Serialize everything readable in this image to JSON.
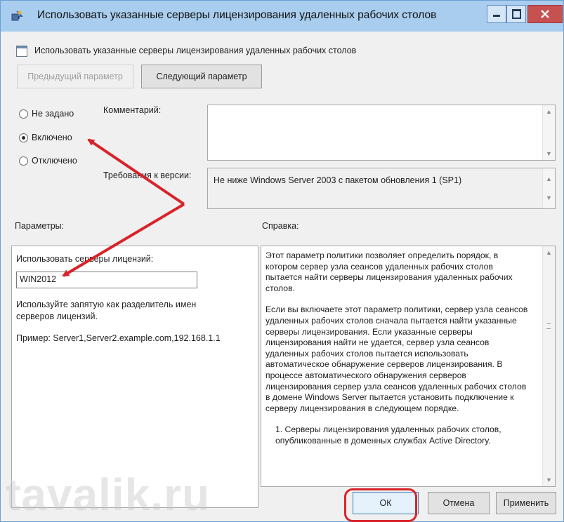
{
  "window": {
    "title": "Использовать указанные серверы лицензирования удаленных рабочих столов",
    "controls": {
      "minimize": "minimize",
      "maximize": "maximize",
      "close": "close"
    }
  },
  "header": {
    "setting_name": "Использовать указанные серверы лицензирования удаленных рабочих столов",
    "prev_button": "Предыдущий параметр",
    "next_button": "Следующий параметр"
  },
  "state": {
    "options": [
      {
        "label": "Не задано",
        "selected": false
      },
      {
        "label": "Включено",
        "selected": true
      },
      {
        "label": "Отключено",
        "selected": false
      }
    ]
  },
  "comment": {
    "label": "Комментарий:",
    "value": ""
  },
  "supported": {
    "label": "Требования к версии:",
    "value": "Не ниже Windows Server 2003 с пакетом обновления 1 (SP1)"
  },
  "params": {
    "label": "Параметры:",
    "servers_label": "Использовать серверы лицензий:",
    "servers_value": "WIN2012",
    "hint": "Используйте запятую как разделитель имен серверов лицензий.",
    "example": "Пример: Server1,Server2.example.com,192.168.1.1"
  },
  "help": {
    "label": "Справка:",
    "p1": "Этот параметр политики позволяет определить порядок, в котором сервер узла сеансов удаленных рабочих столов пытается найти серверы лицензирования удаленных рабочих столов.",
    "p2": "Если вы включаете этот параметр политики, сервер узла сеансов удаленных рабочих столов сначала пытается найти указанные серверы лицензирования. Если указанные серверы лицензирования найти не удается, сервер узла сеансов удаленных рабочих столов пытается использовать автоматическое обнаружение серверов лицензирования. В процессе автоматического обнаружения серверов лицензирования сервер узла сеансов удаленных рабочих столов в домене Windows Server пытается установить подключение к серверу лицензирования в следующем порядке.",
    "p3": "1. Серверы лицензирования удаленных рабочих столов, опубликованные в доменных службах Active Directory."
  },
  "footer": {
    "ok": "ОК",
    "cancel": "Отмена",
    "apply": "Применить"
  },
  "watermark": "tavalik.ru",
  "colors": {
    "annotation": "#d8232a",
    "titlebar": "#a9cdee"
  }
}
